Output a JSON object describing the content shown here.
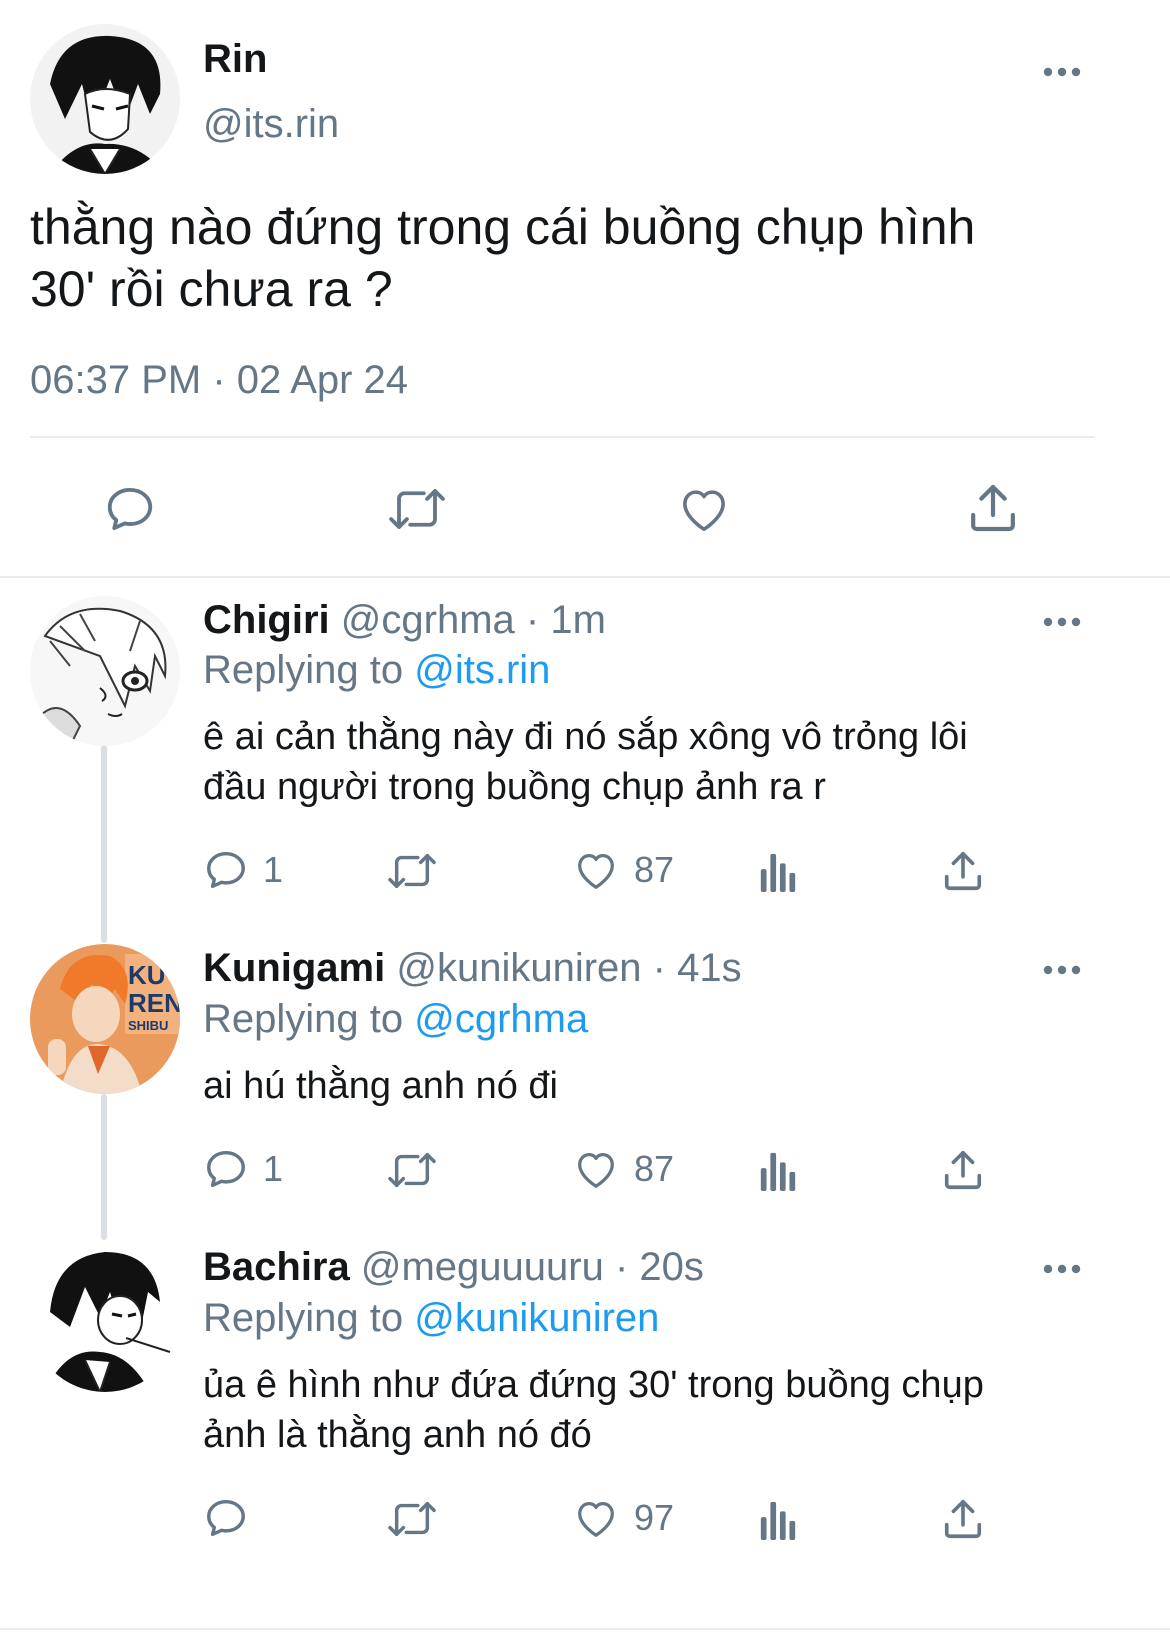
{
  "main_tweet": {
    "author_name": "Rin",
    "author_handle": "@its.rin",
    "text_line1": "thằng nào đứng trong cái buồng chụp hình",
    "text_line2": "30' rồi chưa ra ?",
    "time": "06:37 PM",
    "dot": "·",
    "date": "02 Apr 24"
  },
  "replies": [
    {
      "name": "Chigiri",
      "handle": "@cgrhma",
      "age": "· 1m",
      "replying_prefix": "Replying to",
      "replying_to": "@its.rin",
      "text_line1": "ê ai cản thằng này đi nó sắp xông vô trỏng lôi",
      "text_line2": "đầu người trong buồng chụp ảnh ra r",
      "reply_count": "1",
      "like_count": "87"
    },
    {
      "name": "Kunigami",
      "handle": "@kunikuniren",
      "age": "· 41s",
      "replying_prefix": "Replying to",
      "replying_to": "@cgrhma",
      "text_line1": "ai hú thằng anh nó đi",
      "text_line2": "",
      "reply_count": "1",
      "like_count": "87"
    },
    {
      "name": "Bachira",
      "handle": "@meguuuuru",
      "age": "· 20s",
      "replying_prefix": "Replying to",
      "replying_to": "@kunikuniren",
      "text_line1": "ủa ê hình như đứa đứng 30' trong buồng chụp",
      "text_line2": "ảnh là thằng anh nó đó",
      "reply_count": "",
      "like_count": "97"
    }
  ],
  "colors": {
    "accent": "#1d9bf0",
    "muted": "#657786",
    "divider": "#e6ecf0",
    "text": "#14171a"
  },
  "icons": [
    "reply-icon",
    "retweet-icon",
    "like-icon",
    "share-icon",
    "analytics-icon",
    "more-icon"
  ]
}
